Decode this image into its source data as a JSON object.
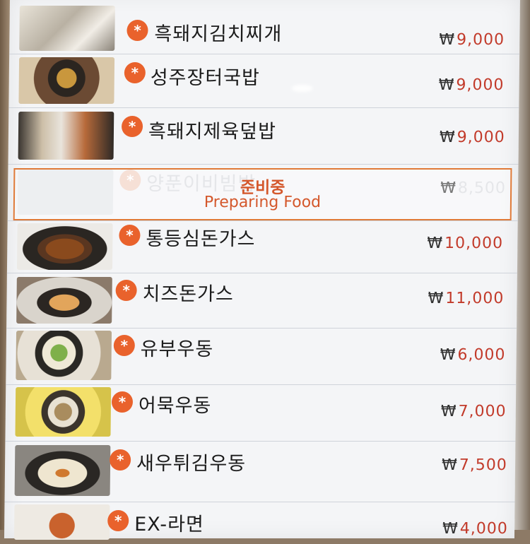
{
  "menu": {
    "currency_symbol": "₩",
    "items": [
      {
        "name": "흑돼지김치찌개",
        "price": "9,000",
        "available": true
      },
      {
        "name": "성주장터국밥",
        "price": "9,000",
        "available": true
      },
      {
        "name": "흑돼지제육덮밥",
        "price": "9,000",
        "available": true
      },
      {
        "name": "양푼이비빔밥",
        "price": "8,500",
        "available": false
      },
      {
        "name": "통등심돈가스",
        "price": "10,000",
        "available": true
      },
      {
        "name": "치즈돈가스",
        "price": "11,000",
        "available": true
      },
      {
        "name": "유부우동",
        "price": "6,000",
        "available": true
      },
      {
        "name": "어묵우동",
        "price": "7,000",
        "available": true
      },
      {
        "name": "새우튀김우동",
        "price": "7,500",
        "available": true
      },
      {
        "name": "EX-라면",
        "price": "4,000",
        "available": true
      }
    ],
    "preparing": {
      "korean": "준비중",
      "english": "Preparing Food"
    },
    "badge_glyph": "*",
    "colors": {
      "accent": "#e9622c",
      "price": "#c23a2a",
      "preparing": "#d4582c"
    }
  }
}
